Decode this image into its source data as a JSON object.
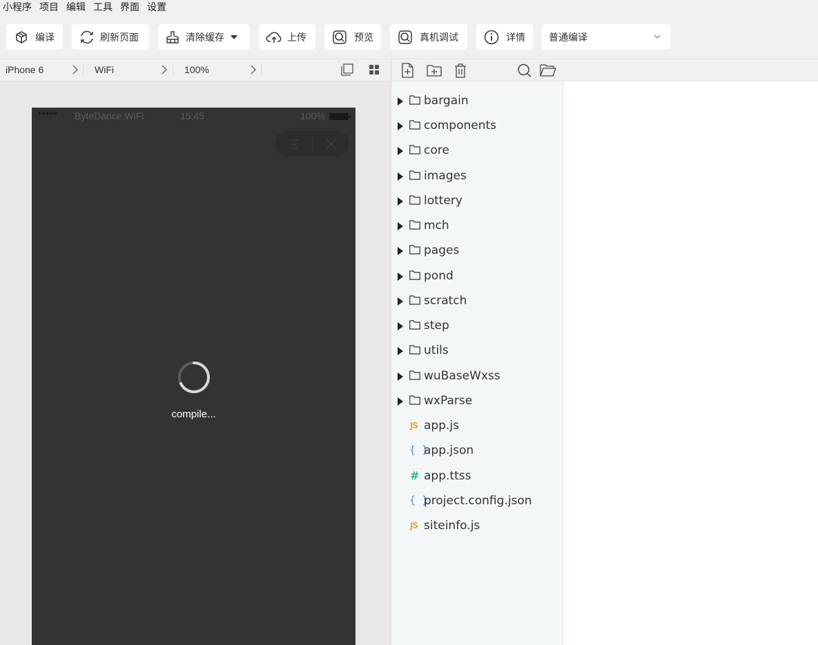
{
  "menu": [
    "小程序",
    "项目",
    "编辑",
    "工具",
    "界面",
    "设置"
  ],
  "toolbar": {
    "compile": "编译",
    "refresh": "刷新页面",
    "clear_cache": "清除缓存",
    "upload": "上传",
    "preview": "预览",
    "remote_debug": "真机调试",
    "details": "详情",
    "compile_mode": "普通编译"
  },
  "simulator": {
    "device": "iPhone 6",
    "network": "WiFi",
    "zoom": "100%",
    "status": {
      "signal": "●●●●●",
      "carrier": "ByteDance WiFi",
      "time": "15:45",
      "battery": "100%"
    },
    "loading_text": "compile..."
  },
  "explorer": {
    "folders": [
      "bargain",
      "components",
      "core",
      "images",
      "lottery",
      "mch",
      "pages",
      "pond",
      "scratch",
      "step",
      "utils",
      "wuBaseWxss",
      "wxParse"
    ],
    "files": [
      {
        "name": "app.js",
        "type": "js",
        "icon": "JS"
      },
      {
        "name": "app.json",
        "type": "json",
        "icon": "{ }"
      },
      {
        "name": "app.ttss",
        "type": "css",
        "icon": "#"
      },
      {
        "name": "project.config.json",
        "type": "json",
        "icon": "{ }"
      },
      {
        "name": "siteinfo.js",
        "type": "js",
        "icon": "JS"
      }
    ]
  },
  "colors": {
    "js_icon": "#e8a93a",
    "json_icon": "#4f8fe0",
    "css_icon": "#2fb58a",
    "phone_bg": "#333333",
    "explorer_bg": "#f3f7f7"
  }
}
